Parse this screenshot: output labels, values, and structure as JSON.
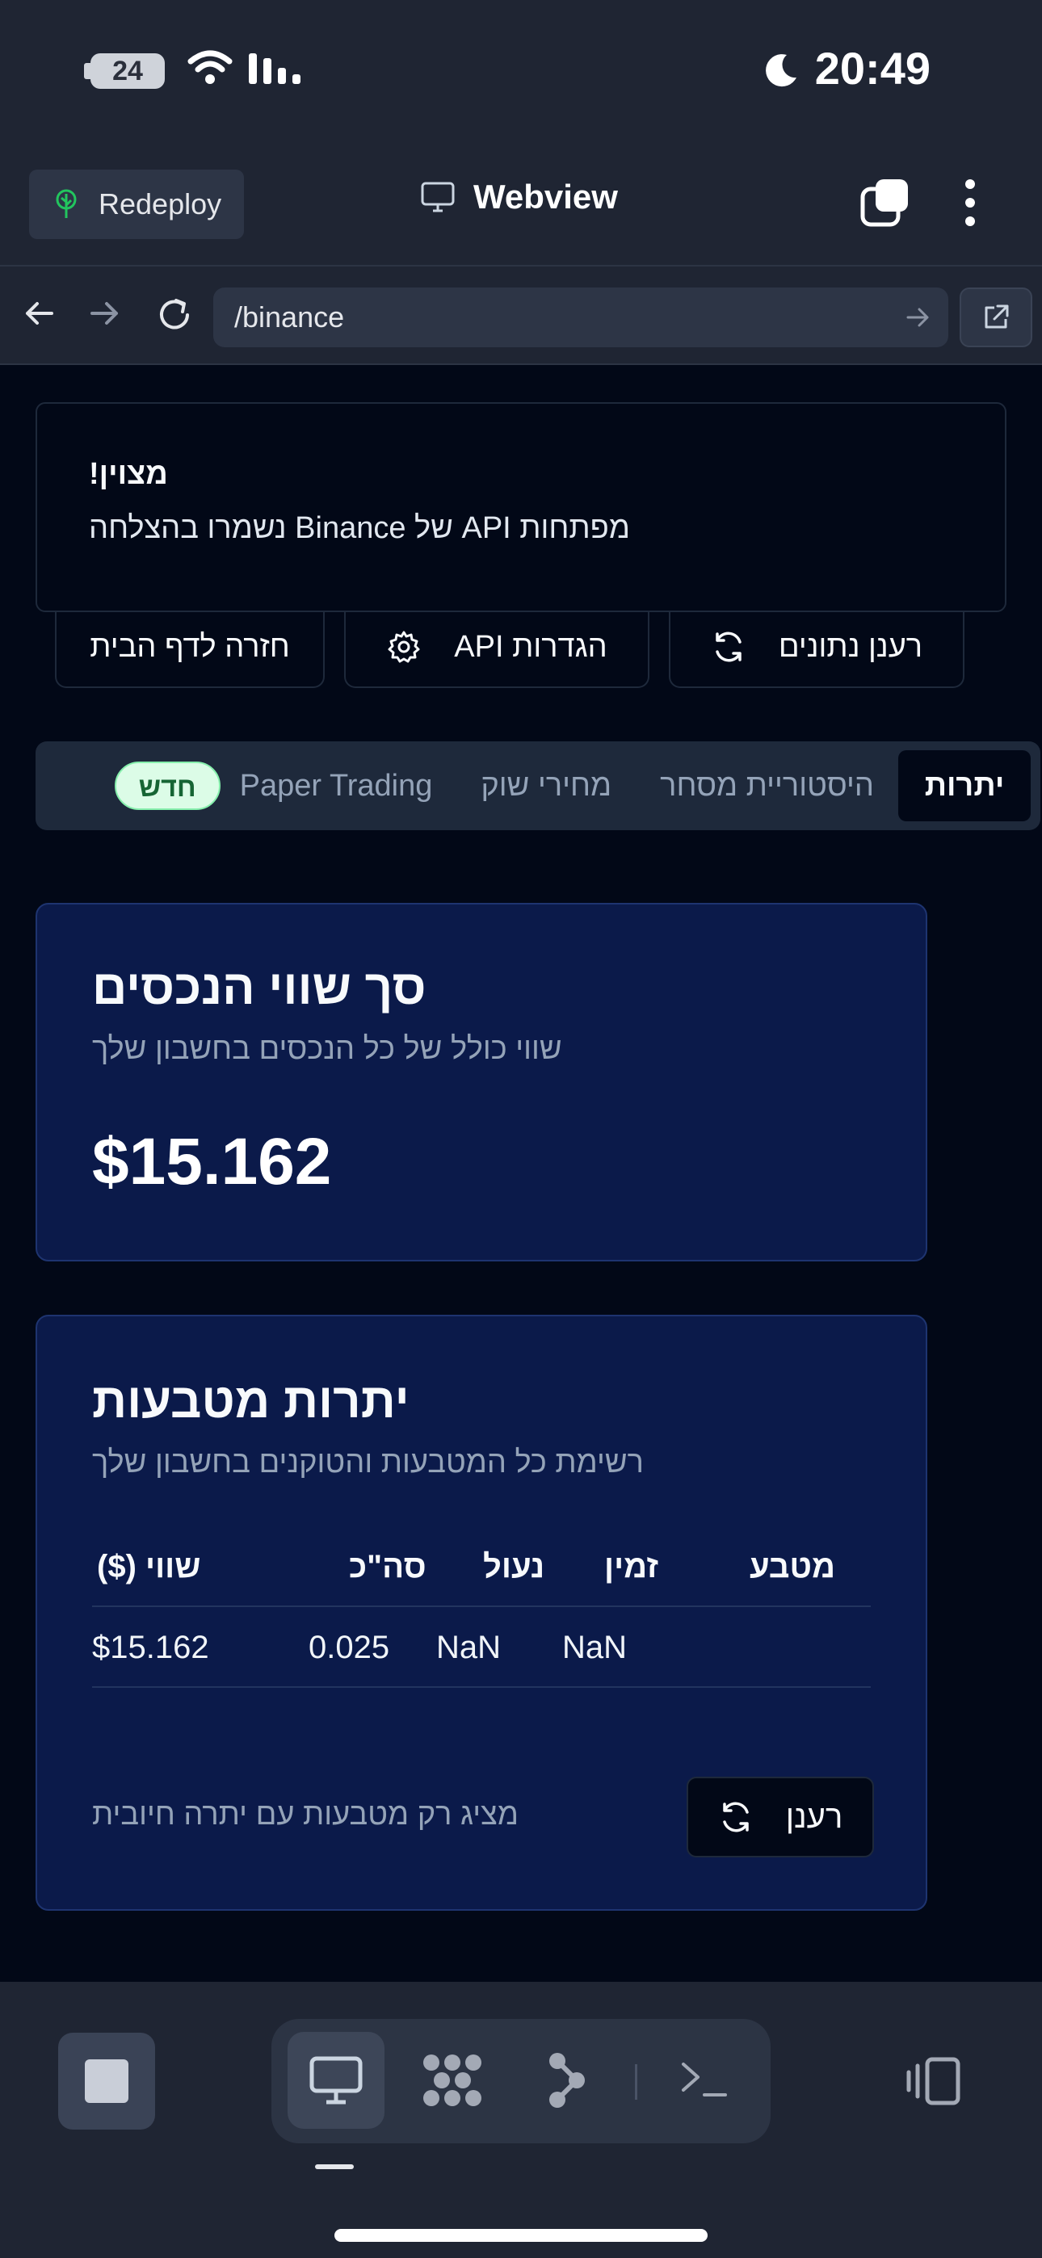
{
  "status_bar": {
    "battery": "24",
    "time": "20:49"
  },
  "toolbar": {
    "redeploy_label": "Redeploy",
    "title": "Webview"
  },
  "navbar": {
    "url": "/binance"
  },
  "toast": {
    "title": "מצוין!",
    "message": "מפתחות API של Binance נשמרו בהצלחה"
  },
  "actions": {
    "refresh_data": "רענן נתונים",
    "api_settings": "הגדרות API",
    "back_home": "חזרה לדף הבית"
  },
  "tabs": [
    {
      "label": "יתרות",
      "active": true
    },
    {
      "label": "היסטוריית מסחר"
    },
    {
      "label": "מחירי שוק"
    },
    {
      "label": "Paper Trading",
      "badge": "חדש"
    }
  ],
  "total_card": {
    "title": "סך שווי הנכסים",
    "subtitle": "שווי כולל של כל הנכסים בחשבון שלך",
    "value": "$15.162"
  },
  "balances_card": {
    "title": "יתרות מטבעות",
    "subtitle": "רשימת כל המטבעות והטוקנים בחשבון שלך",
    "columns": {
      "coin": "מטבע",
      "free": "זמין",
      "locked": "נעול",
      "total": "סה\"כ",
      "value": "שווי ($)"
    },
    "rows": [
      {
        "coin": "",
        "free": "NaN",
        "locked": "NaN",
        "total": "0.025",
        "value": "$15.162"
      }
    ],
    "footnote": "מציג רק מטבעות עם יתרה חיובית",
    "refresh_label": "רענן"
  },
  "colors": {
    "page_bg": "#020817",
    "chrome_bg": "#1f2533",
    "card_bg": "#0b1a4a",
    "badge_bg": "#dcfce7",
    "badge_text": "#166534"
  }
}
